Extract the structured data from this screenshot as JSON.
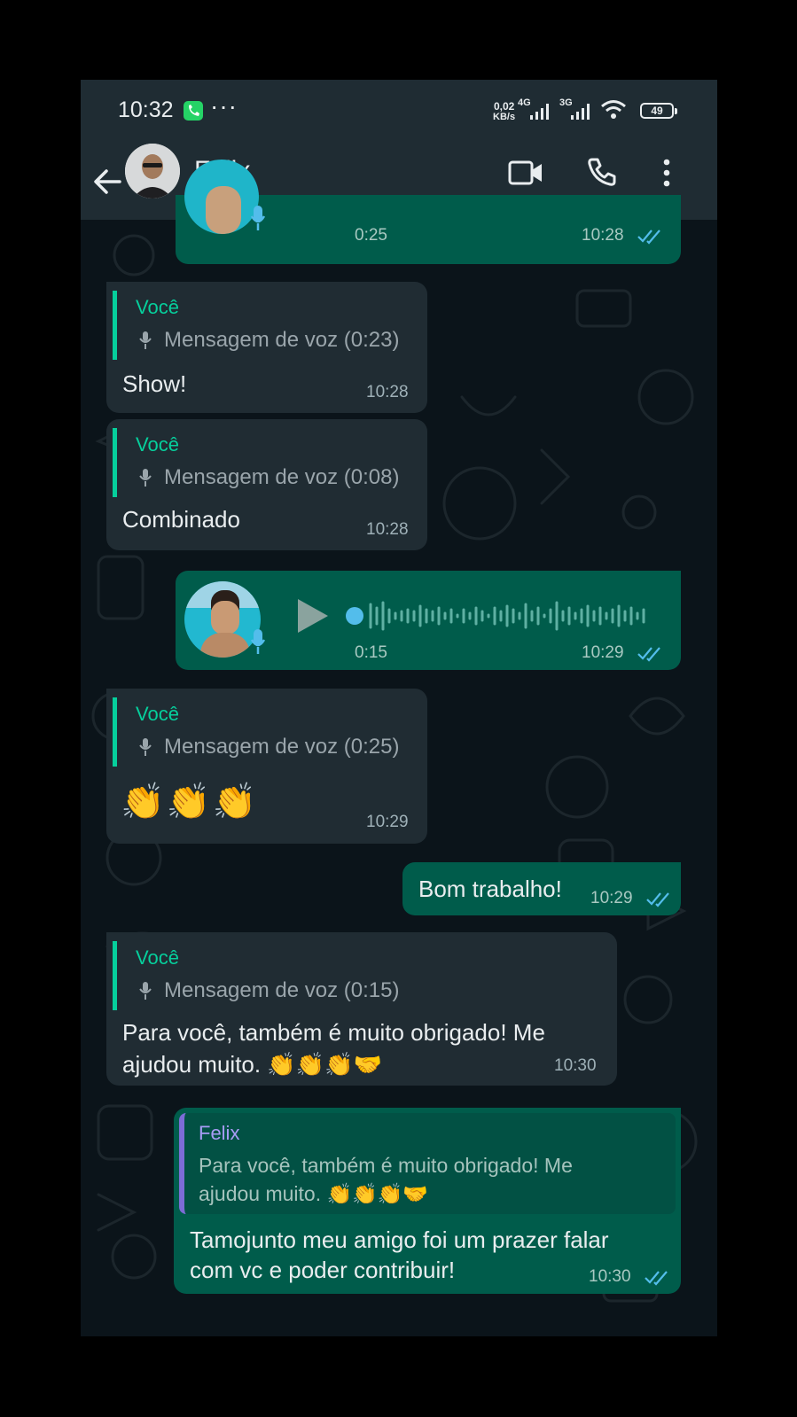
{
  "status": {
    "time": "10:32",
    "dots": "···",
    "net_speed_value": "0,02",
    "net_speed_unit": "KB/s",
    "net1": "4G",
    "net2": "3G",
    "battery": "49"
  },
  "header": {
    "contact_name": "Felix"
  },
  "colors": {
    "header_bg": "#1f2c33",
    "chat_bg": "#0b141a",
    "bubble_in": "#202c33",
    "bubble_out": "#005c4b",
    "accent": "#06cf9c",
    "tick_blue": "#53bdeb"
  },
  "messages": [
    {
      "type": "voice_out",
      "duration": "0:25",
      "time": "10:28"
    },
    {
      "type": "reply_in",
      "quote_author": "Você",
      "quote_text": "Mensagem de voz (0:23)",
      "text": "Show!",
      "time": "10:28"
    },
    {
      "type": "reply_in",
      "quote_author": "Você",
      "quote_text": "Mensagem de voz (0:08)",
      "text": "Combinado",
      "time": "10:28"
    },
    {
      "type": "voice_out",
      "duration": "0:15",
      "time": "10:29"
    },
    {
      "type": "reply_in",
      "quote_author": "Você",
      "quote_text": "Mensagem de voz (0:25)",
      "text": "👏👏👏",
      "time": "10:29"
    },
    {
      "type": "text_out",
      "text": "Bom trabalho!",
      "time": "10:29"
    },
    {
      "type": "reply_in",
      "quote_author": "Você",
      "quote_text": "Mensagem de voz (0:15)",
      "text_line1": "Para você, também é muito obrigado! Me",
      "text_line2": "ajudou muito. 👏👏👏🤝",
      "time": "10:30"
    },
    {
      "type": "reply_out",
      "quote_author": "Felix",
      "quote_line1": "Para você, também é muito obrigado! Me",
      "quote_line2": "ajudou muito. 👏👏👏🤝",
      "text_line1": "Tamojunto meu amigo foi um prazer falar",
      "text_line2": "com vc e poder contribuir!",
      "time": "10:30"
    }
  ]
}
